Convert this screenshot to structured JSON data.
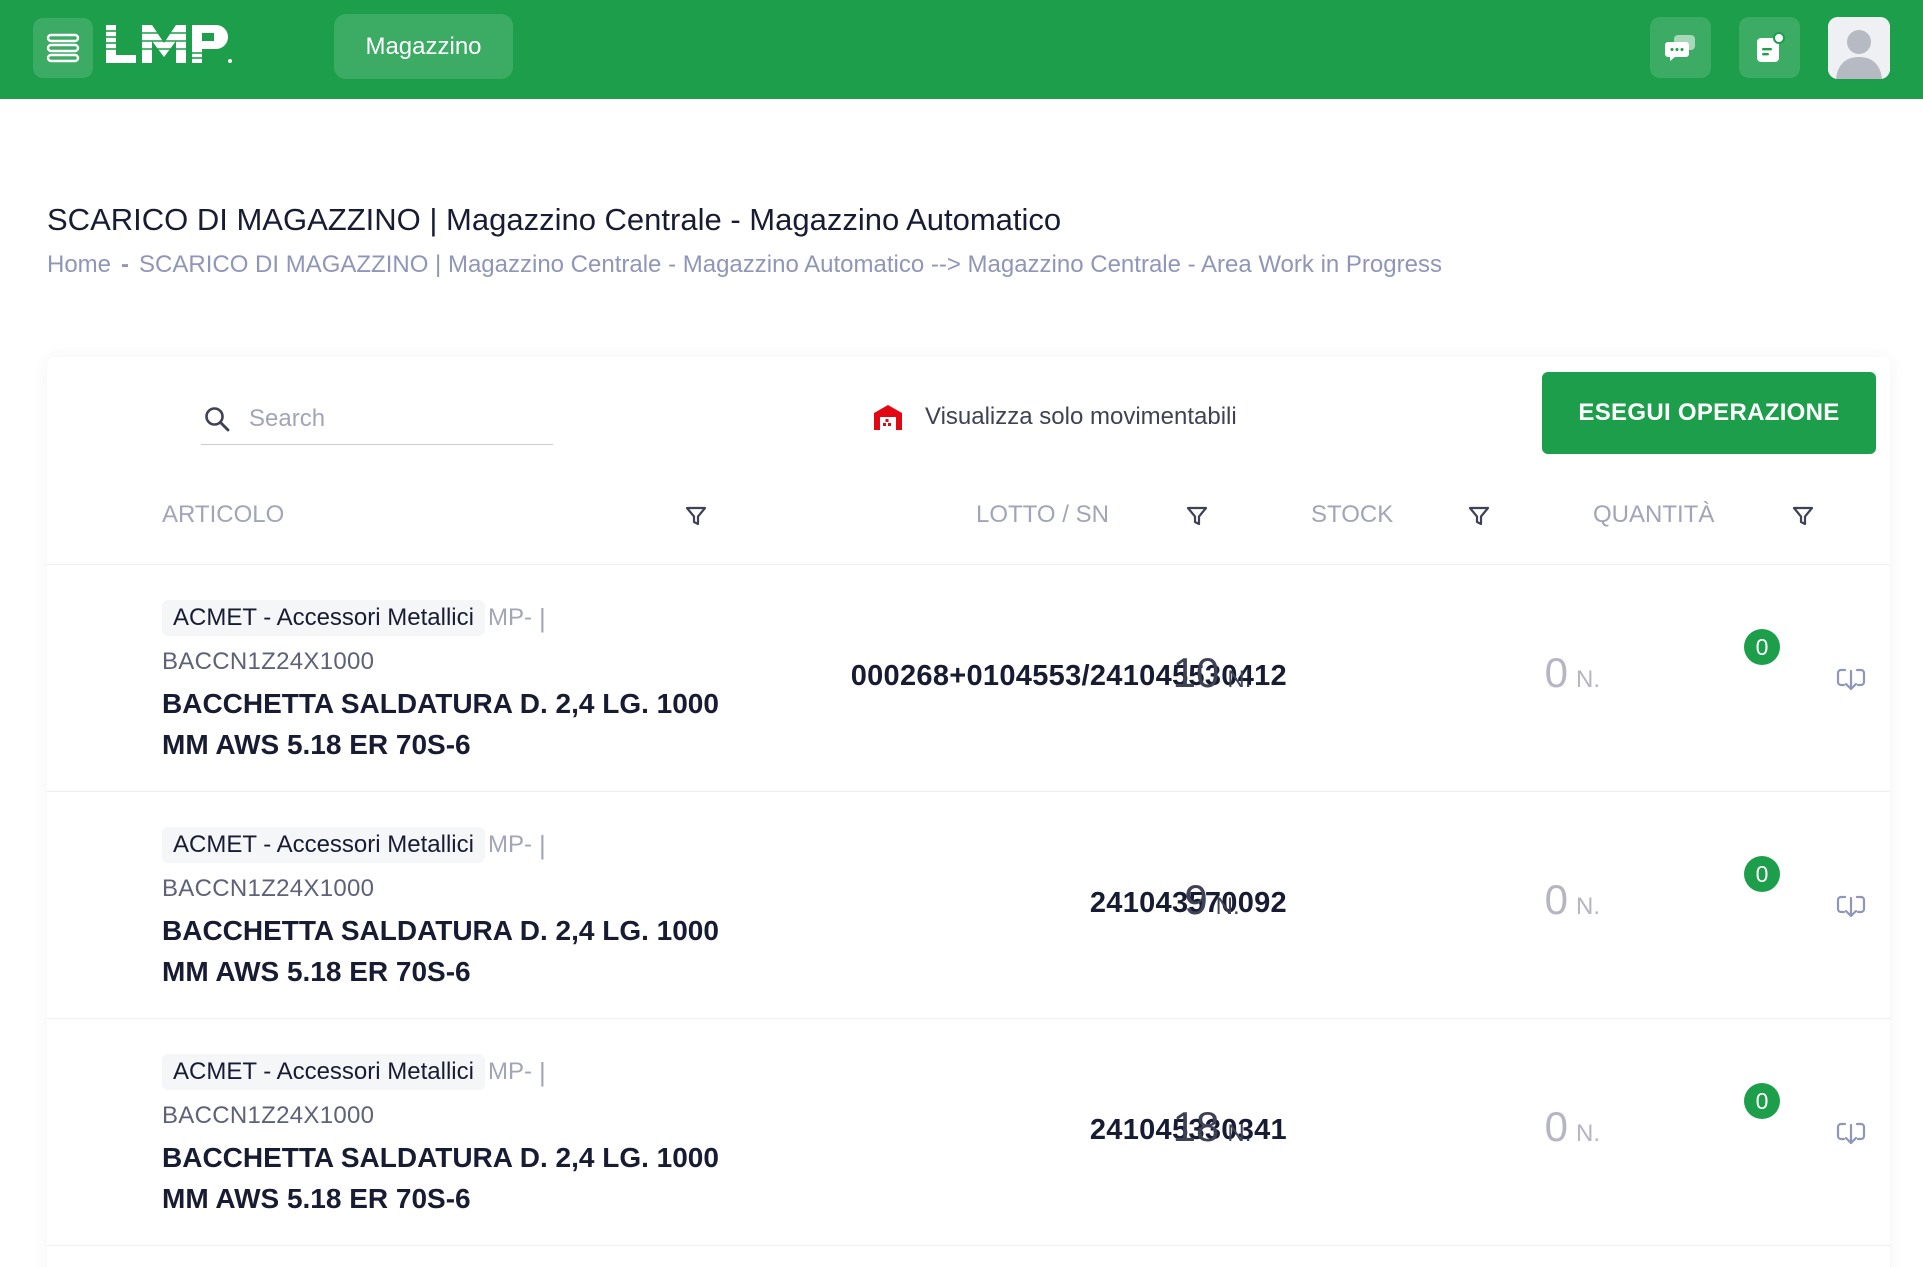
{
  "topbar": {
    "menu_icon": "hamburger-menu-icon",
    "logo_text": "LMP",
    "nav_label": "Magazzino",
    "chat_icon": "chat-bubbles-icon",
    "notes_icon": "notes-icon",
    "avatar_icon": "user-avatar-icon"
  },
  "page": {
    "title": "SCARICO DI MAGAZZINO | Magazzino Centrale - Magazzino Automatico",
    "breadcrumb": {
      "home": "Home",
      "separator": "-",
      "current": "SCARICO DI MAGAZZINO | Magazzino Centrale - Magazzino Automatico --> Magazzino Centrale - Area Work in Progress"
    }
  },
  "toolbar": {
    "search_placeholder": "Search",
    "search_value": "",
    "filter_label": "Visualizza solo movimentabili",
    "filter_icon": "warehouse-icon",
    "filter_icon_color": "#e30613",
    "exec_label": "ESEGUI OPERAZIONE"
  },
  "table": {
    "columns": {
      "articolo": "ARTICOLO",
      "lotto": "LOTTO / SN",
      "stock": "STOCK",
      "quantita": "QUANTITÀ"
    },
    "rows": [
      {
        "category": "ACMET - Accessori Metallici",
        "prefix": "MP-",
        "bar": "|",
        "code": "BACCN1Z24X1000",
        "description": "BACCHETTA SALDATURA D. 2,4 LG. 1000 MM AWS 5.18 ER 70S-6",
        "lotto": "000268+0104553/241045530412",
        "stock": "10",
        "stock_unit": "N.",
        "quantity": "0",
        "quantity_unit": "N.",
        "badge": "0"
      },
      {
        "category": "ACMET - Accessori Metallici",
        "prefix": "MP-",
        "bar": "|",
        "code": "BACCN1Z24X1000",
        "description": "BACCHETTA SALDATURA D. 2,4 LG. 1000 MM AWS 5.18 ER 70S-6",
        "lotto": "241043570092",
        "stock": "9",
        "stock_unit": "N.",
        "quantity": "0",
        "quantity_unit": "N.",
        "badge": "0"
      },
      {
        "category": "ACMET - Accessori Metallici",
        "prefix": "MP-",
        "bar": "|",
        "code": "BACCN1Z24X1000",
        "description": "BACCHETTA SALDATURA D. 2,4 LG. 1000 MM AWS 5.18 ER 70S-6",
        "lotto": "241045330341",
        "stock": "18",
        "stock_unit": "N.",
        "quantity": "0",
        "quantity_unit": "N.",
        "badge": "0"
      }
    ]
  },
  "colors": {
    "brand_green": "#1d9e4b",
    "muted_text": "#a1a5b7",
    "dark_text": "#181c32"
  }
}
